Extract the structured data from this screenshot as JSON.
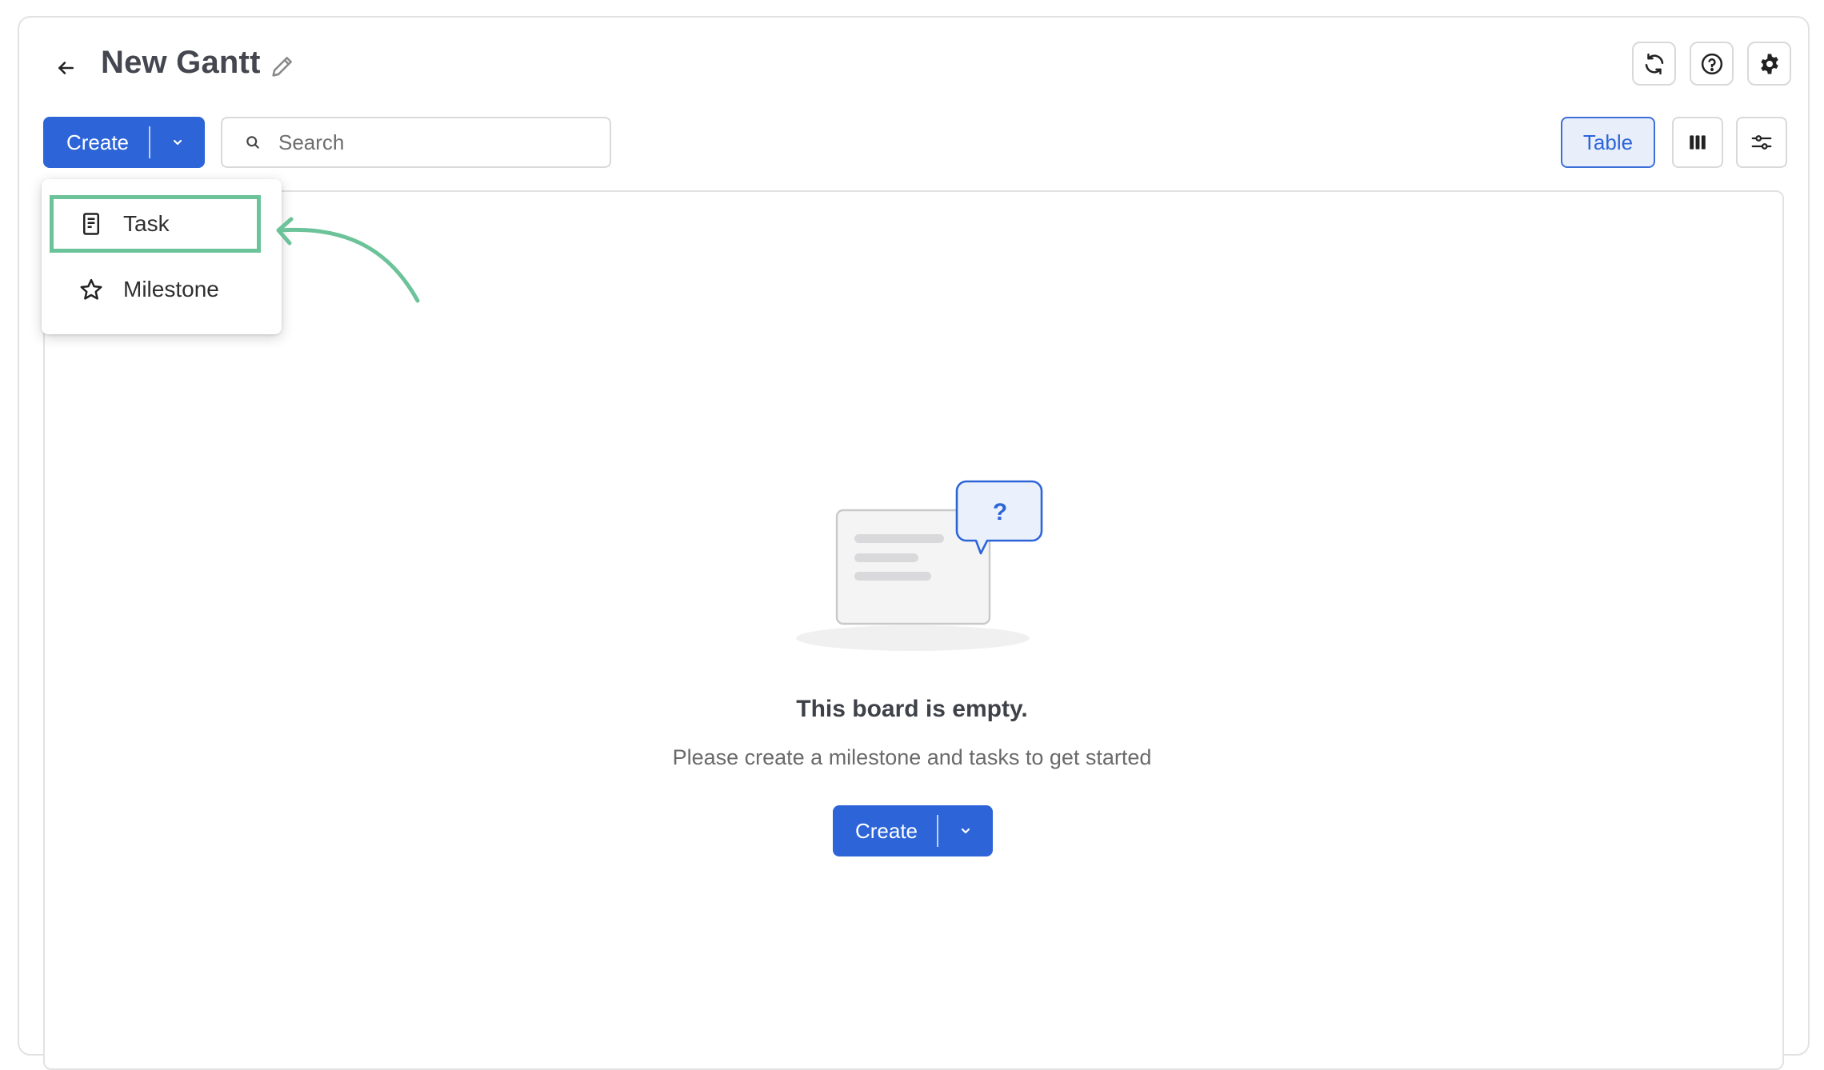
{
  "header": {
    "title": "New Gantt",
    "icons": {
      "back": "arrow-left-icon",
      "edit": "pencil-icon",
      "sync": "sync-icon",
      "help": "help-circle-icon",
      "settings": "gear-icon"
    }
  },
  "toolbar": {
    "create_label": "Create",
    "search_placeholder": "Search",
    "table_label": "Table",
    "icons": {
      "caret": "chevron-down-icon",
      "search": "search-icon",
      "columns": "columns-icon",
      "filters": "sliders-icon"
    }
  },
  "dropdown": {
    "items": [
      {
        "label": "Task",
        "icon": "document-icon",
        "highlighted": true
      },
      {
        "label": "Milestone",
        "icon": "star-icon",
        "highlighted": false
      }
    ]
  },
  "empty_state": {
    "title": "This board is empty.",
    "subtitle": "Please create a milestone and tasks to get started",
    "create_label": "Create",
    "bubble_glyph": "?"
  },
  "colors": {
    "primary": "#2d65d8",
    "highlight": "#6cc39a",
    "table_bg": "#e8effb"
  }
}
